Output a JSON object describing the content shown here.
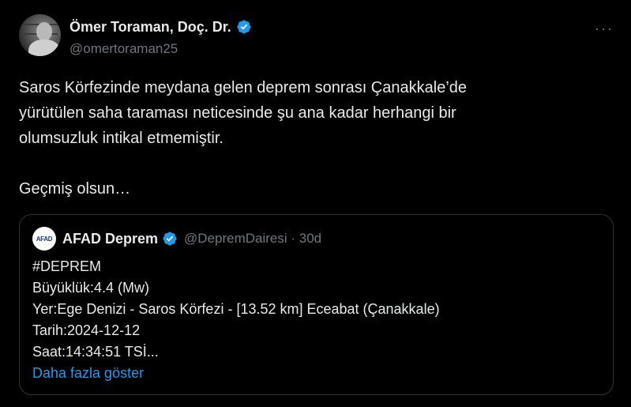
{
  "author": {
    "name": "Ömer Toraman, Doç. Dr.",
    "handle": "@omertoraman25"
  },
  "tweet": {
    "text": "Saros Körfezinde meydana gelen deprem sonrası Çanakkale’de\nyürütülen saha taraması neticesinde şu ana kadar herhangi bir\nolumsuzluk intikal etmemiştir.\n\nGeçmiş olsun…"
  },
  "quote": {
    "logo_text": "AFAD",
    "name": "AFAD Deprem",
    "handle_time": "@DepremDairesi · 30d",
    "lines": [
      "#DEPREM",
      "Büyüklük:4.4 (Mw)",
      "Yer:Ege Denizi - Saros Körfezi - [13.52 km] Eceabat (Çanakkale)",
      "Tarih:2024-12-12",
      "Saat:14:34:51 TSİ..."
    ],
    "show_more": "Daha fazla göster"
  },
  "icons": {
    "more": "more-dots-icon",
    "verified": "verified-badge-icon"
  },
  "colors": {
    "background": "#000000",
    "text": "#e7e9ea",
    "secondary": "#71767b",
    "accent": "#1d9bf0",
    "border": "#2f3336"
  }
}
